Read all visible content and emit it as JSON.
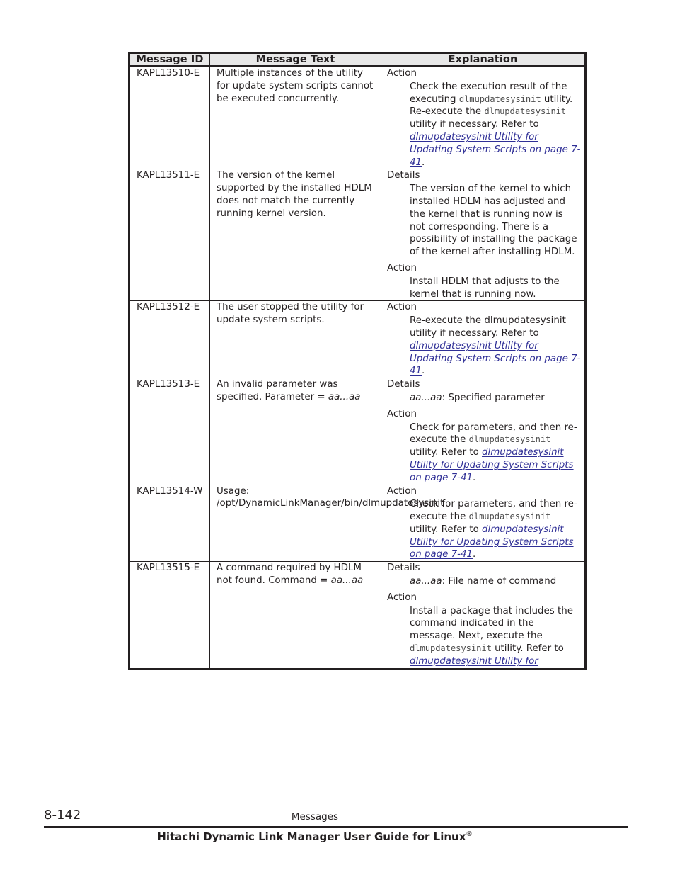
{
  "document": {
    "table": {
      "columns": [
        "Message ID",
        "Message Text",
        "Explanation"
      ],
      "rows": [
        {
          "id": "KAPL13510-E",
          "text": "Multiple instances of the utility for update system scripts cannot be executed concurrently.",
          "explanation": [
            {
              "heading": "Action",
              "segments": [
                {
                  "type": "plain",
                  "text": "Check the execution result of the executing "
                },
                {
                  "type": "mono",
                  "text": "dlmupdatesysinit"
                },
                {
                  "type": "plain",
                  "text": " utility. Re-execute the "
                },
                {
                  "type": "mono",
                  "text": "dlmupdatesysinit"
                },
                {
                  "type": "plain",
                  "text": " utility if necessary. Refer to "
                },
                {
                  "type": "xref",
                  "text": "dlmupdatesysinit Utility for Updating System Scripts on page 7-41"
                },
                {
                  "type": "plain",
                  "text": "."
                }
              ]
            }
          ]
        },
        {
          "id": "KAPL13511-E",
          "text": "The version of the kernel supported by the installed HDLM does not match the currently running kernel version.",
          "explanation": [
            {
              "heading": "Details",
              "segments": [
                {
                  "type": "plain",
                  "text": "The version of the kernel to which installed HDLM has adjusted and the kernel that is running now is not corresponding. There is a possibility of installing the package of the kernel after installing HDLM."
                }
              ]
            },
            {
              "heading": "Action",
              "segments": [
                {
                  "type": "plain",
                  "text": "Install HDLM that adjusts to the kernel that is running now."
                }
              ]
            }
          ]
        },
        {
          "id": "KAPL13512-E",
          "text": "The user stopped the utility for update system scripts.",
          "explanation": [
            {
              "heading": "Action",
              "segments": [
                {
                  "type": "plain",
                  "text": "Re-execute the dlmupdatesysinit utility if necessary. Refer to "
                },
                {
                  "type": "xref",
                  "text": "dlmupdatesysinit Utility for Updating System Scripts on page 7-41"
                },
                {
                  "type": "plain",
                  "text": "."
                }
              ]
            }
          ]
        },
        {
          "id": "KAPL13513-E",
          "text_segments": [
            {
              "type": "plain",
              "text": "An invalid parameter was specified. Parameter = "
            },
            {
              "type": "ital",
              "text": "aa...aa"
            }
          ],
          "explanation": [
            {
              "heading": "Details",
              "segments": [
                {
                  "type": "ital",
                  "text": "aa...aa"
                },
                {
                  "type": "plain",
                  "text": ": Specified parameter"
                }
              ]
            },
            {
              "heading": "Action",
              "segments": [
                {
                  "type": "plain",
                  "text": "Check for parameters, and then re-execute the "
                },
                {
                  "type": "mono",
                  "text": "dlmupdatesysinit"
                },
                {
                  "type": "plain",
                  "text": " utility. Refer to "
                },
                {
                  "type": "xref",
                  "text": "dlmupdatesysinit Utility for Updating System Scripts on page 7-41"
                },
                {
                  "type": "plain",
                  "text": "."
                }
              ]
            }
          ]
        },
        {
          "id": "KAPL13514-W",
          "text": "Usage: /opt/DynamicLinkManager/bin/dlmupdatesysinit",
          "explanation": [
            {
              "heading": "Action",
              "segments": [
                {
                  "type": "plain",
                  "text": "Check for parameters, and then re-execute the "
                },
                {
                  "type": "mono",
                  "text": "dlmupdatesysinit"
                },
                {
                  "type": "plain",
                  "text": " utility. Refer to "
                },
                {
                  "type": "xref",
                  "text": "dlmupdatesysinit Utility for Updating System Scripts on page 7-41"
                },
                {
                  "type": "plain",
                  "text": "."
                }
              ]
            }
          ]
        },
        {
          "id": "KAPL13515-E",
          "text_segments": [
            {
              "type": "plain",
              "text": "A command required by HDLM not found. Command = "
            },
            {
              "type": "ital",
              "text": "aa...aa"
            }
          ],
          "explanation": [
            {
              "heading": "Details",
              "segments": [
                {
                  "type": "ital",
                  "text": "aa...aa"
                },
                {
                  "type": "plain",
                  "text": ": File name of command"
                }
              ]
            },
            {
              "heading": "Action",
              "segments": [
                {
                  "type": "plain",
                  "text": "Install a package that includes the command indicated in the message. Next, execute the "
                },
                {
                  "type": "mono",
                  "text": "dlmupdatesysinit"
                },
                {
                  "type": "plain",
                  "text": " utility. Refer to "
                },
                {
                  "type": "xref",
                  "text": "dlmupdatesysinit Utility for"
                }
              ]
            }
          ]
        }
      ]
    },
    "footer": {
      "page_number": "8-142",
      "running_head": "Messages",
      "book_title": "Hitachi Dynamic Link Manager User Guide for Linux",
      "book_title_mark": "®"
    },
    "colors": {
      "text": "#231f20",
      "link": "#2f2f96",
      "header_fill": "#e8e8e8",
      "mono": "#4d4d4d"
    }
  }
}
